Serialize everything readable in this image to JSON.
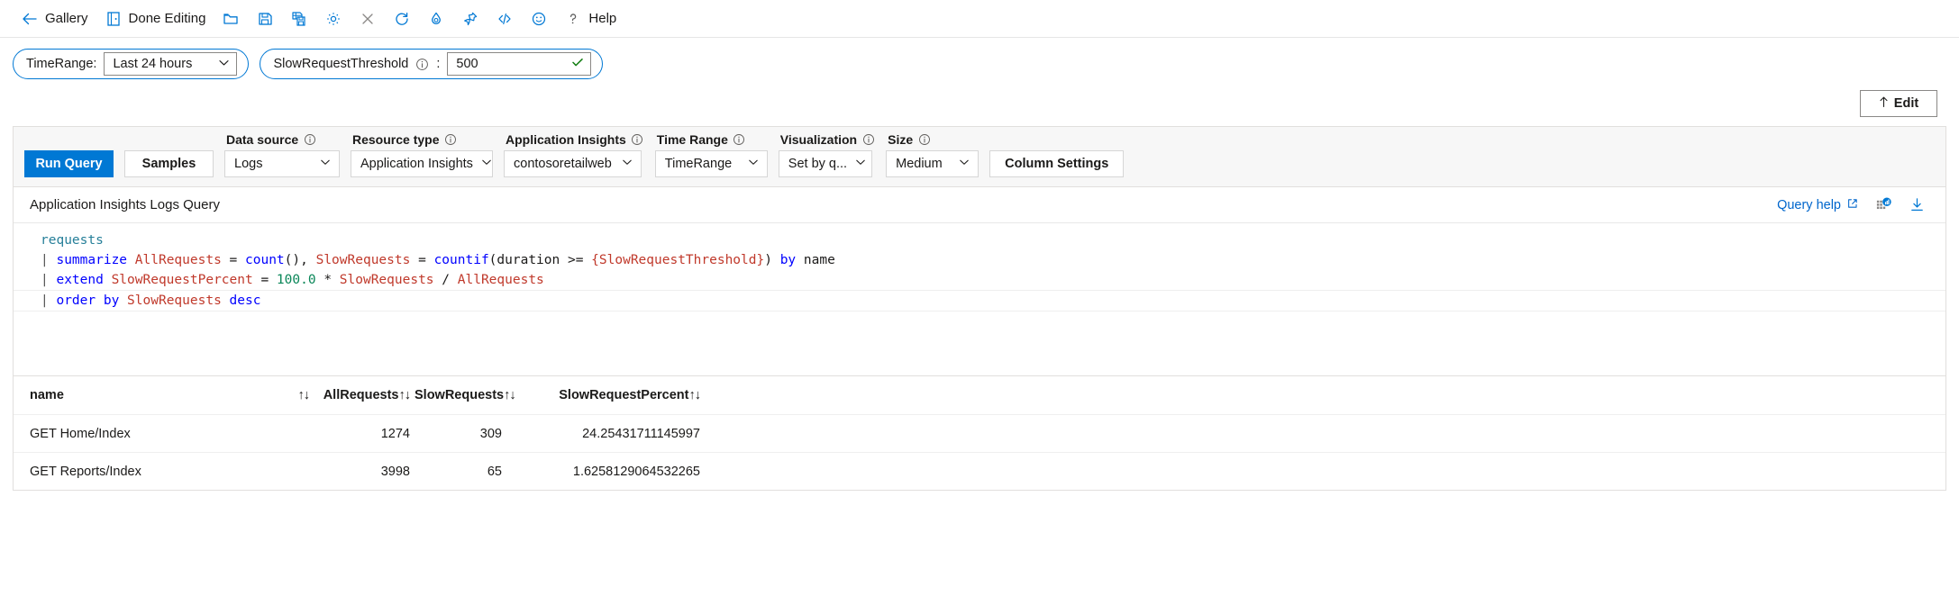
{
  "toolbar": {
    "items": [
      {
        "icon": "back-arrow-icon",
        "label": "Gallery"
      },
      {
        "icon": "done-editing-icon",
        "label": "Done Editing"
      },
      {
        "icon": "open-folder-icon",
        "label": ""
      },
      {
        "icon": "save-icon",
        "label": ""
      },
      {
        "icon": "save-as-icon",
        "label": ""
      },
      {
        "icon": "settings-gear-icon",
        "label": ""
      },
      {
        "icon": "close-x-icon",
        "label": ""
      },
      {
        "icon": "refresh-icon",
        "label": ""
      },
      {
        "icon": "privacy-icon",
        "label": ""
      },
      {
        "icon": "pin-icon",
        "label": ""
      },
      {
        "icon": "code-icon",
        "label": ""
      },
      {
        "icon": "feedback-smiley-icon",
        "label": ""
      },
      {
        "icon": "help-question-icon",
        "label": "Help"
      }
    ]
  },
  "parameters": [
    {
      "name": "TimeRange",
      "label": "TimeRange:",
      "has_info": false,
      "control": "select",
      "value": "Last 24 hours"
    },
    {
      "name": "SlowRequestThreshold",
      "label": "SlowRequestThreshold",
      "has_info": true,
      "separator": ":",
      "control": "input",
      "value": "500",
      "validation": "valid"
    }
  ],
  "edit_button": {
    "label": "Edit",
    "icon": "pencil-up-icon"
  },
  "query_toolbar": {
    "run_query_label": "Run Query",
    "samples_label": "Samples",
    "column_settings_label": "Column Settings",
    "fields": [
      {
        "name": "data-source",
        "label": "Data source",
        "value": "Logs"
      },
      {
        "name": "resource-type",
        "label": "Resource type",
        "value": "Application Insights"
      },
      {
        "name": "application-insights",
        "label": "Application Insights",
        "value": "contosoretailweb"
      },
      {
        "name": "time-range",
        "label": "Time Range",
        "value": "TimeRange"
      },
      {
        "name": "visualization",
        "label": "Visualization",
        "value": "Set by q..."
      },
      {
        "name": "size",
        "label": "Size",
        "value": "Medium"
      }
    ]
  },
  "query_header": {
    "title": "Application Insights Logs Query",
    "query_help_label": "Query help",
    "icons": [
      "external-link-icon",
      "sample-data-icon",
      "download-icon"
    ]
  },
  "query_lines": [
    [
      {
        "t": "requests",
        "c": "table"
      }
    ],
    [
      {
        "t": "| ",
        "c": "pipe"
      },
      {
        "t": "summarize ",
        "c": "kw"
      },
      {
        "t": "AllRequests ",
        "c": "id"
      },
      {
        "t": "= ",
        "c": "plain"
      },
      {
        "t": "count",
        "c": "kw"
      },
      {
        "t": "(), ",
        "c": "plain"
      },
      {
        "t": "SlowRequests ",
        "c": "id"
      },
      {
        "t": "= ",
        "c": "plain"
      },
      {
        "t": "countif",
        "c": "kw"
      },
      {
        "t": "(duration >= ",
        "c": "plain"
      },
      {
        "t": "{SlowRequestThreshold}",
        "c": "id"
      },
      {
        "t": ") ",
        "c": "plain"
      },
      {
        "t": "by ",
        "c": "kw"
      },
      {
        "t": "name",
        "c": "plain"
      }
    ],
    [
      {
        "t": "| ",
        "c": "pipe"
      },
      {
        "t": "extend ",
        "c": "kw"
      },
      {
        "t": "SlowRequestPercent ",
        "c": "id"
      },
      {
        "t": "= ",
        "c": "plain"
      },
      {
        "t": "100.0 ",
        "c": "num"
      },
      {
        "t": "* ",
        "c": "plain"
      },
      {
        "t": "SlowRequests ",
        "c": "id"
      },
      {
        "t": "/ ",
        "c": "plain"
      },
      {
        "t": "AllRequests",
        "c": "id"
      }
    ],
    [
      {
        "t": "| ",
        "c": "pipe"
      },
      {
        "t": "order by ",
        "c": "kw"
      },
      {
        "t": "SlowRequests ",
        "c": "id"
      },
      {
        "t": "desc",
        "c": "kw"
      }
    ]
  ],
  "results": {
    "sort_glyph": "↑↓",
    "columns": [
      {
        "name": "name",
        "label": "name",
        "align": "left"
      },
      {
        "name": "all-requests",
        "label": "AllRequests",
        "align": "right"
      },
      {
        "name": "slow-requests",
        "label": "SlowRequests",
        "align": "right"
      },
      {
        "name": "slow-request-percent",
        "label": "SlowRequestPercent",
        "align": "right"
      }
    ],
    "rows": [
      {
        "name": "GET Home/Index",
        "all": "1274",
        "slow": "309",
        "pct": "24.25431711145997"
      },
      {
        "name": "GET Reports/Index",
        "all": "3998",
        "slow": "65",
        "pct": "1.6258129064532265"
      }
    ]
  },
  "colors": {
    "accent": "#0078d4",
    "link": "#0066cc",
    "valid_check": "#107c10",
    "code_table": "#267f99",
    "code_keyword": "#0000ff",
    "code_identifier": "#c0392b",
    "code_number": "#098658"
  }
}
